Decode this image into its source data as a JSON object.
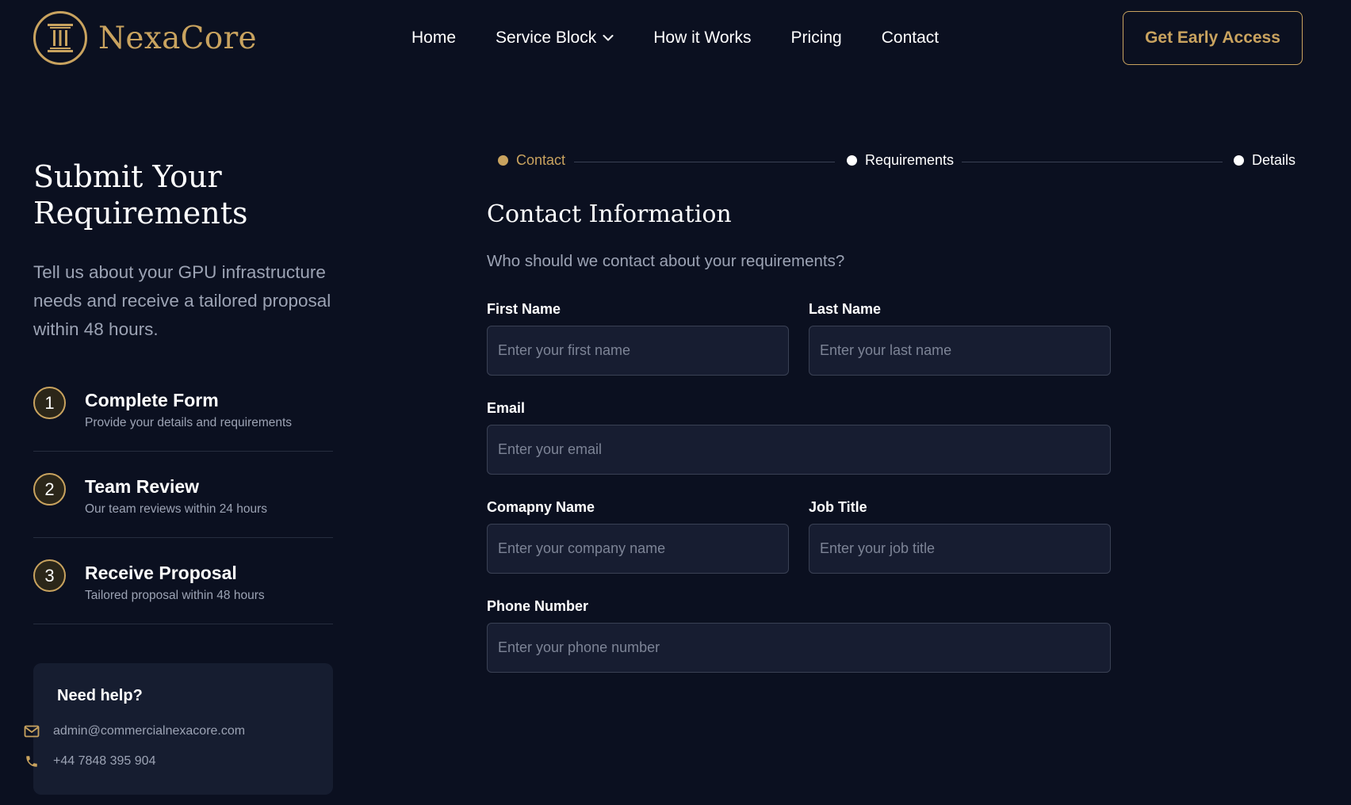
{
  "brand": {
    "name": "NexaCore",
    "accent_color": "#c9a35f",
    "logo_icon": "pillar-icon"
  },
  "nav": {
    "items": [
      {
        "label": "Home"
      },
      {
        "label": "Service Block",
        "icon": "chevron-down-icon"
      },
      {
        "label": "How it Works"
      },
      {
        "label": "Pricing"
      },
      {
        "label": "Contact"
      }
    ],
    "cta_label": "Get Early Access"
  },
  "intro": {
    "title": "Submit Your Requirements",
    "description": "Tell us about your GPU infrastructure needs and receive a tailored proposal within 48 hours."
  },
  "steps": [
    {
      "number": "1",
      "title": "Complete Form",
      "subtitle": "Provide your details and requirements"
    },
    {
      "number": "2",
      "title": "Team Review",
      "subtitle": "Our team reviews within 24 hours"
    },
    {
      "number": "3",
      "title": "Receive Proposal",
      "subtitle": "Tailored proposal within 48 hours"
    }
  ],
  "help": {
    "title": "Need help?",
    "email": "admin@commercialnexacore.com",
    "email_icon": "mail-icon",
    "phone": "+44 7848 395 904",
    "phone_icon": "phone-icon"
  },
  "stepper": {
    "steps": [
      {
        "label": "Contact",
        "state": "active"
      },
      {
        "label": "Requirements",
        "state": "inactive"
      },
      {
        "label": "Details",
        "state": "inactive"
      }
    ]
  },
  "form": {
    "title": "Contact Information",
    "subtitle": "Who should we contact about your requirements?",
    "fields": {
      "first_name": {
        "label": "First Name",
        "placeholder": "Enter your first name",
        "value": ""
      },
      "last_name": {
        "label": "Last Name",
        "placeholder": "Enter your last name",
        "value": ""
      },
      "email": {
        "label": "Email",
        "placeholder": "Enter your email",
        "value": ""
      },
      "company": {
        "label": "Comapny Name",
        "placeholder": "Enter your company name",
        "value": ""
      },
      "job_title": {
        "label": "Job Title",
        "placeholder": "Enter your job title",
        "value": ""
      },
      "phone": {
        "label": "Phone Number",
        "placeholder": "Enter your phone number",
        "value": ""
      }
    }
  }
}
